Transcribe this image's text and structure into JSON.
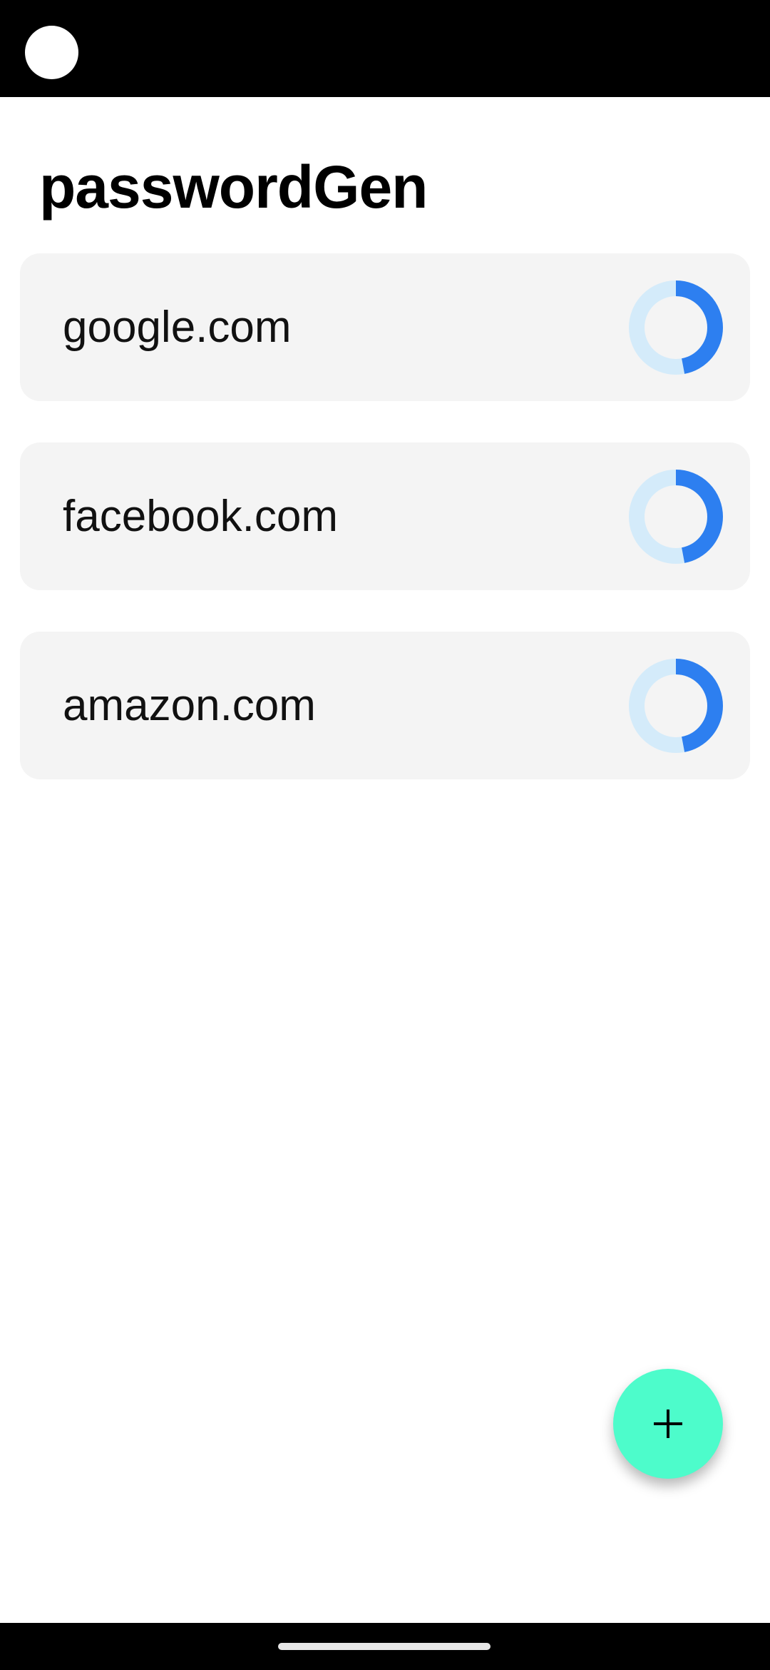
{
  "app": {
    "title": "passwordGen"
  },
  "colors": {
    "card_background": "#f4f4f4",
    "ring_track": "#d4ebfa",
    "ring_fill": "#2d7ff0",
    "fab_background": "#4dfccb"
  },
  "sites": [
    {
      "label": "google.com",
      "strength": 0.47
    },
    {
      "label": "facebook.com",
      "strength": 0.47
    },
    {
      "label": "amazon.com",
      "strength": 0.47
    }
  ],
  "fab": {
    "icon": "plus-icon"
  }
}
